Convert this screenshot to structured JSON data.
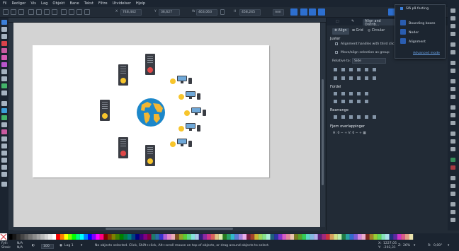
{
  "menubar": {
    "items": [
      "Fil",
      "Rediger",
      "Vis",
      "Lag",
      "Objekt",
      "Bane",
      "Tekst",
      "Filtre",
      "Utvidelser",
      "Hjelp"
    ]
  },
  "toolctl": {
    "x_val": "748,442",
    "y_val": "36,627",
    "w_val": "463,063",
    "h_val": "458,245",
    "unit": "mm"
  },
  "dock": {
    "tabs": [
      "Align and Distrib..."
    ],
    "subtabs": {
      "align": "Align",
      "grid": "Grid",
      "circular": "Circular"
    },
    "juster": "Juster",
    "opt1": "Alignment handles with third clic...",
    "opt2": "Move/align selection as group",
    "relative_label": "Relative to:",
    "relative_value": "Side",
    "fordel": "Fordel",
    "rearrange": "Rearrange",
    "fjern": "Fjern overlappinger",
    "h_label": "H:",
    "h_val": "0",
    "v_label": "V:",
    "v_val": "0"
  },
  "popup": {
    "snap": "Slå på festing",
    "bbox": "Bounding boxes",
    "nodes": "Noder",
    "alignment": "Alignment",
    "advanced": "Advanced mode"
  },
  "status": {
    "fyll_label": "Fyll:",
    "strek_label": "Strek:",
    "fill_val": "N/A",
    "stroke_val": "N/A",
    "opacity": "100",
    "layer": "Lag 1",
    "message": "No objects selected. Click, Shift+click, Alt+scroll mouse on top of objects, or drag around objects to select.",
    "x_label": "X:",
    "x_val": "1227,05",
    "y_label": "Y:",
    "y_val": "-203,31",
    "z_label": "Z:",
    "z_val": "26%",
    "r_label": "R:",
    "r_val": "0,00°"
  },
  "colors": {
    "accent": "#2d6fcf",
    "canvas": "#d3d3d3",
    "page": "#ffffff",
    "globe_ocean": "#1c87c9",
    "globe_land": "#f2b632",
    "server_body": "#3a3d44",
    "emoji_yellow": "#f7c52c",
    "emoji_red": "#e04848"
  }
}
